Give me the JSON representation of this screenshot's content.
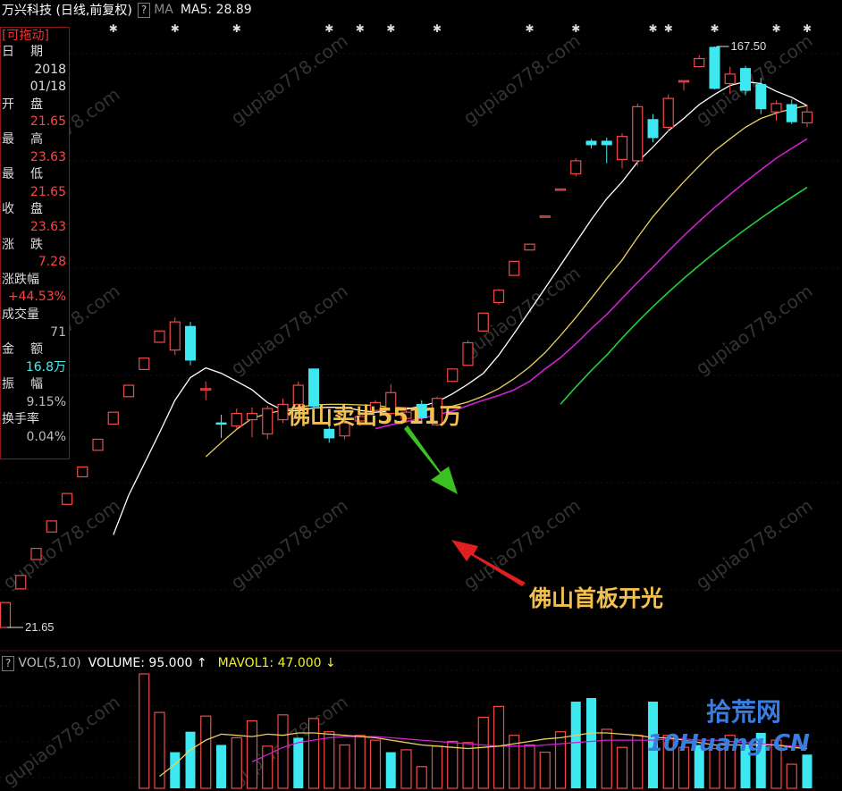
{
  "header": {
    "title": "万兴科技 (日线,前复权)",
    "help_label": "?",
    "ma_label": "MA",
    "ma5_text": "MA5: 28.89"
  },
  "info_panel": {
    "header": "[可拖动]",
    "rows": [
      {
        "label": "日 期",
        "value": "2018"
      },
      {
        "label": "",
        "value": "01/18"
      },
      {
        "label": "开 盘",
        "value": "21.65",
        "color": "red"
      },
      {
        "label": "最 高",
        "value": "23.63",
        "color": "red"
      },
      {
        "label": "最 低",
        "value": "21.65",
        "color": "red"
      },
      {
        "label": "收 盘",
        "value": "23.63",
        "color": "red"
      },
      {
        "label": "涨 跌",
        "value": "7.28",
        "color": "red"
      },
      {
        "label": "涨跌幅",
        "value": "+44.53%",
        "color": "red"
      },
      {
        "label": "成交量",
        "value": "71",
        "color": "grey"
      },
      {
        "label": "金 额",
        "value": "16.8万",
        "color": "cyan"
      },
      {
        "label": "振 幅",
        "value": "9.15%",
        "color": "grey"
      },
      {
        "label": "换手率",
        "value": "0.04%",
        "color": "grey"
      }
    ]
  },
  "volume_header": {
    "help_label": "?",
    "label": "VOL(5,10)",
    "volume_text": "VOLUME: 95.000 ↑",
    "mavol_text": "MAVOL1: 47.000 ↓"
  },
  "annotations": {
    "sell": "佛山卖出5511万",
    "first_board": "佛山首板开光"
  },
  "watermark": "gupiao778.com",
  "logo": {
    "text1": "拾荒网",
    "text2": "10Huang.CN"
  },
  "colors": {
    "up": "#f24a4a",
    "down": "#3ee8f0",
    "ma5": "#ffffff",
    "ma10": "#e8d060",
    "ma20": "#d020d0",
    "ma60": "#1fd03a",
    "annot": "#f2c050",
    "green_arrow": "#3ac020",
    "red_arrow": "#e02020"
  },
  "chart_data": {
    "type": "candlestick",
    "price_labels": {
      "low": "21.65",
      "high": "167.50"
    },
    "candles": [
      {
        "o": 21.65,
        "h": 23.63,
        "l": 21.65,
        "c": 23.63
      },
      {
        "o": 24.8,
        "h": 26.0,
        "l": 24.8,
        "c": 26.0
      },
      {
        "o": 27.5,
        "h": 28.6,
        "l": 27.5,
        "c": 28.6
      },
      {
        "o": 30.3,
        "h": 31.5,
        "l": 30.3,
        "c": 31.5
      },
      {
        "o": 33.4,
        "h": 34.7,
        "l": 33.4,
        "c": 34.7
      },
      {
        "o": 36.8,
        "h": 38.1,
        "l": 36.8,
        "c": 38.1
      },
      {
        "o": 40.4,
        "h": 42.0,
        "l": 40.4,
        "c": 42.0
      },
      {
        "o": 44.3,
        "h": 46.2,
        "l": 44.3,
        "c": 46.2
      },
      {
        "o": 48.8,
        "h": 50.8,
        "l": 48.8,
        "c": 50.8
      },
      {
        "o": 53.7,
        "h": 55.9,
        "l": 53.7,
        "c": 55.9
      },
      {
        "o": 59.1,
        "h": 61.5,
        "l": 59.1,
        "c": 61.5
      },
      {
        "o": 57.5,
        "h": 64.5,
        "l": 56.5,
        "c": 63.5
      },
      {
        "o": 62.5,
        "h": 63.5,
        "l": 54.5,
        "c": 55.5
      },
      {
        "o": 50.0,
        "h": 51.5,
        "l": 48.2,
        "c": 50.2
      },
      {
        "o": 44.5,
        "h": 45.8,
        "l": 42.2,
        "c": 44.4
      },
      {
        "o": 44.0,
        "h": 46.8,
        "l": 43.5,
        "c": 46.0
      },
      {
        "o": 45.0,
        "h": 47.0,
        "l": 42.3,
        "c": 46.0
      },
      {
        "o": 42.8,
        "h": 47.3,
        "l": 42.0,
        "c": 46.8
      },
      {
        "o": 45.0,
        "h": 48.5,
        "l": 44.5,
        "c": 47.5
      },
      {
        "o": 47.5,
        "h": 51.5,
        "l": 47.0,
        "c": 50.8
      },
      {
        "o": 53.8,
        "h": 53.8,
        "l": 46.5,
        "c": 47.2
      },
      {
        "o": 43.5,
        "h": 45.0,
        "l": 41.5,
        "c": 42.2
      },
      {
        "o": 42.5,
        "h": 44.8,
        "l": 42.0,
        "c": 44.5
      },
      {
        "o": 44.8,
        "h": 46.2,
        "l": 44.0,
        "c": 45.5
      },
      {
        "o": 46.5,
        "h": 48.2,
        "l": 46.5,
        "c": 47.8
      },
      {
        "o": 46.0,
        "h": 51.0,
        "l": 45.5,
        "c": 49.5
      },
      {
        "o": 45.2,
        "h": 47.0,
        "l": 44.5,
        "c": 46.2
      },
      {
        "o": 47.5,
        "h": 48.2,
        "l": 44.8,
        "c": 45.3
      },
      {
        "o": 44.2,
        "h": 48.8,
        "l": 44.0,
        "c": 48.5
      },
      {
        "o": 51.5,
        "h": 53.8,
        "l": 51.5,
        "c": 53.8
      },
      {
        "o": 54.5,
        "h": 59.5,
        "l": 54.5,
        "c": 59.0
      },
      {
        "o": 61.5,
        "h": 65.5,
        "l": 61.5,
        "c": 65.5
      },
      {
        "o": 68.0,
        "h": 71.3,
        "l": 67.5,
        "c": 71.0
      },
      {
        "o": 74.8,
        "h": 78.6,
        "l": 74.8,
        "c": 78.6
      },
      {
        "o": 81.8,
        "h": 83.5,
        "l": 81.8,
        "c": 83.5
      },
      {
        "o": 92.2,
        "h": 92.2,
        "l": 92.2,
        "c": 92.2
      },
      {
        "o": 101.4,
        "h": 101.4,
        "l": 101.4,
        "c": 101.4
      },
      {
        "o": 107.0,
        "h": 113.0,
        "l": 106.0,
        "c": 112.0
      },
      {
        "o": 120.0,
        "h": 121.0,
        "l": 117.0,
        "c": 118.5
      },
      {
        "o": 120.0,
        "h": 121.5,
        "l": 111.0,
        "c": 118.5
      },
      {
        "o": 112.5,
        "h": 123.5,
        "l": 109.0,
        "c": 122.0
      },
      {
        "o": 112.0,
        "h": 137.0,
        "l": 110.0,
        "c": 135.5
      },
      {
        "o": 129.5,
        "h": 132.0,
        "l": 119.5,
        "c": 121.5
      },
      {
        "o": 126.0,
        "h": 141.5,
        "l": 124.0,
        "c": 139.5
      },
      {
        "o": 148.5,
        "h": 148.5,
        "l": 143.5,
        "c": 148.5
      },
      {
        "o": 156.0,
        "h": 162.5,
        "l": 155.5,
        "c": 160.5
      },
      {
        "o": 167.0,
        "h": 167.5,
        "l": 144.0,
        "c": 144.5
      },
      {
        "o": 147.0,
        "h": 156.0,
        "l": 142.0,
        "c": 152.0
      },
      {
        "o": 155.0,
        "h": 156.5,
        "l": 141.0,
        "c": 143.5
      },
      {
        "o": 146.5,
        "h": 150.0,
        "l": 132.0,
        "c": 134.5
      },
      {
        "o": 133.0,
        "h": 138.5,
        "l": 129.0,
        "c": 137.0
      },
      {
        "o": 136.5,
        "h": 139.0,
        "l": 127.5,
        "c": 128.5
      },
      {
        "o": 128.0,
        "h": 136.5,
        "l": 126.0,
        "c": 133.0
      }
    ],
    "ma5": [
      null,
      null,
      null,
      null,
      null,
      null,
      null,
      30.0,
      34.5,
      38.5,
      43.0,
      48.2,
      52.2,
      54.0,
      53.0,
      51.5,
      50.0,
      47.8,
      46.5,
      46.4,
      46.9,
      47.0,
      47.0,
      46.5,
      46.2,
      46.4,
      46.7,
      47.2,
      47.9,
      49.3,
      51.0,
      53.0,
      56.5,
      61.0,
      66.0,
      71.5,
      77.5,
      84.0,
      91.0,
      98.0,
      104.0,
      111.5,
      117.5,
      124.5,
      130.0,
      136.5,
      141.5,
      146.0,
      148.0,
      147.0,
      143.0,
      140.0,
      136.0
    ],
    "ma10": [
      null,
      null,
      null,
      null,
      null,
      null,
      null,
      null,
      null,
      null,
      null,
      null,
      null,
      39.5,
      41.5,
      43.5,
      45.2,
      46.0,
      46.5,
      47.0,
      47.4,
      47.5,
      47.5,
      47.4,
      47.3,
      47.0,
      46.9,
      46.8,
      46.9,
      47.2,
      47.9,
      48.9,
      50.2,
      52.0,
      54.2,
      57.0,
      60.5,
      64.5,
      69.0,
      74.0,
      79.0,
      85.5,
      92.0,
      98.0,
      104.0,
      110.0,
      116.0,
      121.0,
      126.0,
      130.0,
      132.5,
      134.5,
      136.0
    ],
    "ma20": [
      null,
      null,
      null,
      null,
      null,
      null,
      null,
      null,
      null,
      null,
      null,
      null,
      null,
      null,
      null,
      null,
      null,
      null,
      null,
      null,
      null,
      null,
      null,
      null,
      43.6,
      44.2,
      44.7,
      45.2,
      45.8,
      46.4,
      47.3,
      48.2,
      49.0,
      50.0,
      51.5,
      53.8,
      56.0,
      58.8,
      62.0,
      65.2,
      69.0,
      73.0,
      77.0,
      81.5,
      86.0,
      90.5,
      95.0,
      99.5,
      104.0,
      108.5,
      113.0,
      117.0,
      121.0
    ],
    "ma60": [
      null,
      null,
      null,
      null,
      null,
      null,
      null,
      null,
      null,
      null,
      null,
      null,
      null,
      null,
      null,
      null,
      null,
      null,
      null,
      null,
      null,
      null,
      null,
      null,
      null,
      null,
      null,
      null,
      null,
      null,
      null,
      null,
      null,
      null,
      null,
      null,
      47.5,
      50.5,
      53.5,
      56.5,
      60.0,
      63.5,
      67.0,
      70.5,
      74.0,
      77.5,
      81.0,
      84.5,
      88.0,
      91.5,
      95.0,
      98.5,
      102.0
    ],
    "volume_up": [
      null,
      null,
      null,
      null,
      null,
      null,
      null,
      null,
      null,
      null,
      null,
      null,
      1,
      0,
      0,
      0,
      0,
      0,
      0,
      0,
      0,
      0,
      0,
      0,
      0,
      0,
      0,
      0,
      0,
      0,
      0,
      0,
      0,
      0,
      0,
      0,
      0,
      0,
      0,
      0,
      0,
      0,
      0,
      0,
      0,
      0,
      0,
      0,
      0,
      0,
      0,
      0,
      0
    ],
    "volume": [
      null,
      null,
      null,
      null,
      null,
      null,
      null,
      null,
      null,
      95,
      63,
      30,
      47,
      60,
      36,
      42,
      56,
      35,
      61,
      42,
      58,
      47,
      36,
      44,
      40,
      30,
      32,
      18,
      35,
      39,
      38,
      59,
      68,
      44,
      36,
      30,
      47,
      72,
      75,
      49,
      34,
      44,
      72,
      44,
      34,
      36,
      33,
      44,
      36,
      46,
      40,
      20,
      28
    ],
    "volume_dir": [
      null,
      null,
      null,
      null,
      null,
      null,
      null,
      null,
      null,
      "u",
      "u",
      "d",
      "d",
      "u",
      "d",
      "u",
      "u",
      "u",
      "u",
      "d",
      "u",
      "u",
      "u",
      "u",
      "u",
      "d",
      "u",
      "u",
      "u",
      "u",
      "u",
      "u",
      "u",
      "u",
      "u",
      "u",
      "u",
      "d",
      "d",
      "u",
      "u",
      "u",
      "d",
      "u",
      "u",
      "d",
      "u",
      "u",
      "d",
      "d",
      "u",
      "u",
      "d"
    ],
    "mavol1": [
      null,
      null,
      null,
      null,
      null,
      null,
      null,
      null,
      null,
      null,
      10,
      20,
      32,
      40,
      45,
      44,
      43,
      45,
      44,
      46,
      46,
      45,
      44,
      43,
      42,
      40,
      38,
      36,
      35,
      34,
      33,
      34,
      35,
      37,
      39,
      41,
      42,
      44,
      46,
      46,
      45,
      44,
      42,
      42,
      40,
      38,
      36,
      36,
      36,
      36,
      36,
      34,
      33
    ],
    "mavol2": [
      null,
      null,
      null,
      null,
      null,
      null,
      null,
      null,
      null,
      null,
      null,
      null,
      null,
      null,
      null,
      null,
      22,
      28,
      34,
      38,
      40,
      42,
      43,
      43,
      43,
      42,
      41,
      40,
      39,
      38,
      37,
      36,
      35,
      35,
      35,
      36,
      37,
      38,
      39,
      40,
      40,
      40,
      40,
      41,
      41,
      40,
      40,
      39,
      38,
      37,
      36,
      35,
      35
    ]
  }
}
